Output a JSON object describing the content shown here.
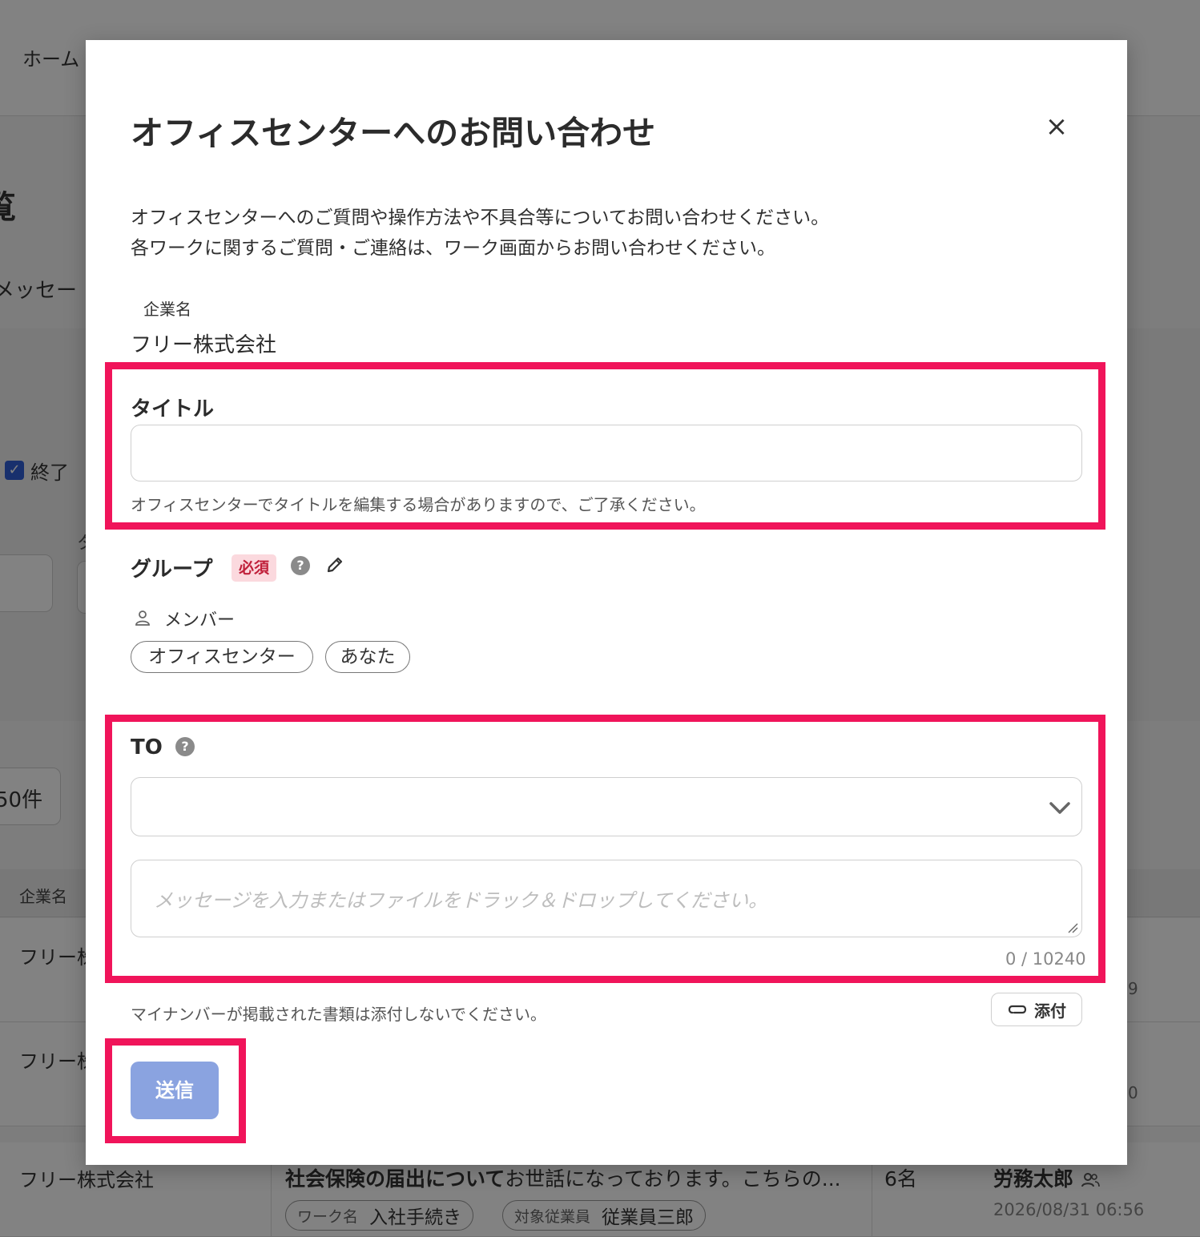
{
  "background": {
    "nav_home": "ホーム",
    "page_title_fragment": "覧",
    "tab_fragment": "メッセー",
    "filter_checkbox_label": "終了",
    "filter_label_fragment": "タ",
    "page_size_fragment": "50件",
    "table_header_company": "企業名",
    "rows": [
      {
        "company": "フリー株"
      },
      {
        "company": "フリー株"
      },
      {
        "company": "フリー株式会社",
        "subject_bold": "社会保険の届出について",
        "subject_rest": "お世話になっております。こちらの...",
        "chip1_key": "ワーク名",
        "chip1_value": "入社手続き",
        "chip2_key": "対象従業員",
        "chip2_value": "従業員三郎",
        "member_count": "6名",
        "sender": "労務太郎",
        "datetime": "2026/08/31 06:56"
      }
    ],
    "right_fragment_1": "9",
    "right_fragment_2": "0"
  },
  "modal": {
    "title": "オフィスセンターへのお問い合わせ",
    "close_glyph": "×",
    "description_line1": "オフィスセンターへのご質問や操作方法や不具合等についてお問い合わせください。",
    "description_line2": "各ワークに関するご質問・ご連絡は、ワーク画面からお問い合わせください。",
    "company_label": "企業名",
    "company_value": "フリー株式会社",
    "title_field": {
      "label": "タイトル",
      "value": "",
      "hint": "オフィスセンターでタイトルを編集する場合がありますので、ご了承ください。"
    },
    "group": {
      "label": "グループ",
      "required_badge": "必須",
      "help_glyph": "?",
      "members_label": "メンバー",
      "members": [
        "オフィスセンター",
        "あなた"
      ]
    },
    "to": {
      "label": "TO",
      "help_glyph": "?",
      "selected": ""
    },
    "message": {
      "placeholder": "メッセージを入力またはファイルをドラック＆ドロップしてください。",
      "counter": "0 / 10240"
    },
    "attach_note": "マイナンバーが掲載された書類は添付しないでください。",
    "attach_label": "添付",
    "submit_label": "送信"
  },
  "highlight_color": "#f0145a",
  "accent_button_color": "#8aa3e0",
  "icons": [
    "close-icon",
    "help-icon",
    "pencil-icon",
    "person-icon",
    "chevron-down-icon",
    "paperclip-icon",
    "checkbox-icon",
    "people-icon"
  ]
}
